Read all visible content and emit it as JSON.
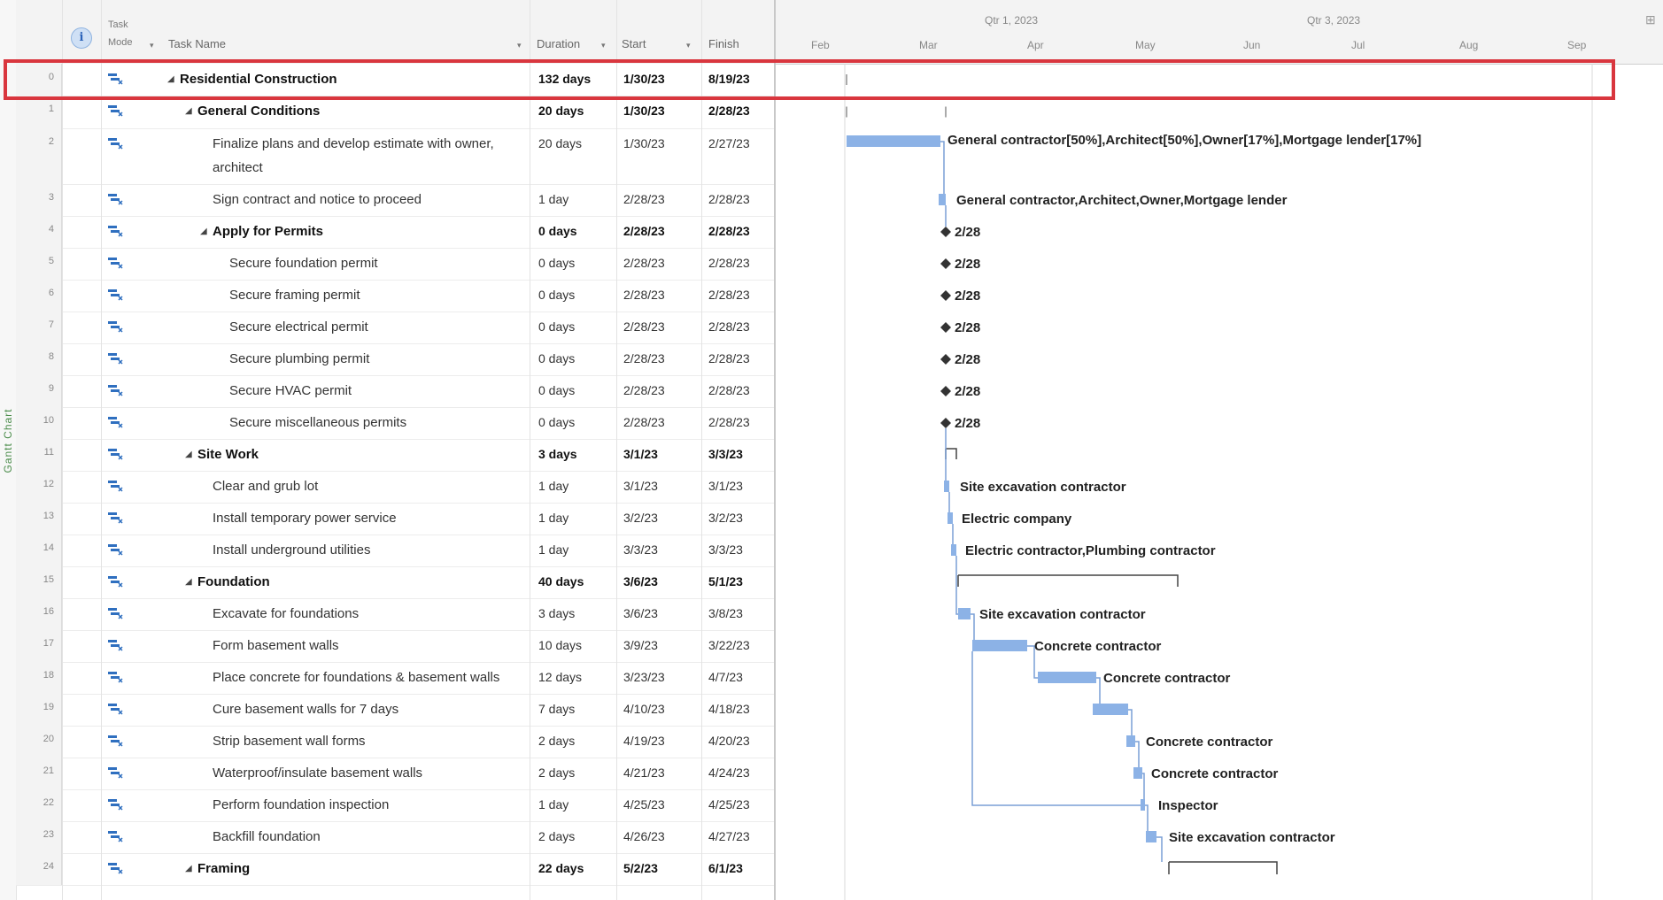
{
  "side_label": "Gantt Chart",
  "columns": {
    "mode_top": "Task",
    "mode_bottom": "Mode",
    "name": "Task Name",
    "duration": "Duration",
    "start": "Start",
    "finish": "Finish"
  },
  "timeline": {
    "quarters": [
      "Qtr 1, 2023",
      "Qtr 3, 2023"
    ],
    "months": [
      "Feb",
      "Mar",
      "Apr",
      "May",
      "Jun",
      "Jul",
      "Aug",
      "Sep"
    ]
  },
  "tasks": [
    {
      "id": "0",
      "name": "Residential Construction",
      "duration": "132 days",
      "start": "1/30/23",
      "finish": "8/19/23",
      "level": 0,
      "summary": true
    },
    {
      "id": "1",
      "name": "General Conditions",
      "duration": "20 days",
      "start": "1/30/23",
      "finish": "2/28/23",
      "level": 1,
      "summary": true
    },
    {
      "id": "2",
      "name": "Finalize plans and develop estimate with owner,",
      "name2": "architect",
      "duration": "20 days",
      "start": "1/30/23",
      "finish": "2/27/23",
      "level": 2,
      "summary": false
    },
    {
      "id": "3",
      "name": "Sign contract and notice to proceed",
      "duration": "1 day",
      "start": "2/28/23",
      "finish": "2/28/23",
      "level": 2,
      "summary": false
    },
    {
      "id": "4",
      "name": "Apply for Permits",
      "duration": "0 days",
      "start": "2/28/23",
      "finish": "2/28/23",
      "level": 2,
      "summary": true
    },
    {
      "id": "5",
      "name": "Secure foundation permit",
      "duration": "0 days",
      "start": "2/28/23",
      "finish": "2/28/23",
      "level": 3,
      "summary": false
    },
    {
      "id": "6",
      "name": "Secure framing permit",
      "duration": "0 days",
      "start": "2/28/23",
      "finish": "2/28/23",
      "level": 3,
      "summary": false
    },
    {
      "id": "7",
      "name": "Secure electrical permit",
      "duration": "0 days",
      "start": "2/28/23",
      "finish": "2/28/23",
      "level": 3,
      "summary": false
    },
    {
      "id": "8",
      "name": "Secure plumbing permit",
      "duration": "0 days",
      "start": "2/28/23",
      "finish": "2/28/23",
      "level": 3,
      "summary": false
    },
    {
      "id": "9",
      "name": "Secure HVAC permit",
      "duration": "0 days",
      "start": "2/28/23",
      "finish": "2/28/23",
      "level": 3,
      "summary": false
    },
    {
      "id": "10",
      "name": "Secure miscellaneous permits",
      "duration": "0 days",
      "start": "2/28/23",
      "finish": "2/28/23",
      "level": 3,
      "summary": false
    },
    {
      "id": "11",
      "name": "Site Work",
      "duration": "3 days",
      "start": "3/1/23",
      "finish": "3/3/23",
      "level": 1,
      "summary": true
    },
    {
      "id": "12",
      "name": "Clear and grub lot",
      "duration": "1 day",
      "start": "3/1/23",
      "finish": "3/1/23",
      "level": 2,
      "summary": false
    },
    {
      "id": "13",
      "name": "Install temporary power service",
      "duration": "1 day",
      "start": "3/2/23",
      "finish": "3/2/23",
      "level": 2,
      "summary": false
    },
    {
      "id": "14",
      "name": "Install underground utilities",
      "duration": "1 day",
      "start": "3/3/23",
      "finish": "3/3/23",
      "level": 2,
      "summary": false
    },
    {
      "id": "15",
      "name": "Foundation",
      "duration": "40 days",
      "start": "3/6/23",
      "finish": "5/1/23",
      "level": 1,
      "summary": true
    },
    {
      "id": "16",
      "name": "Excavate for foundations",
      "duration": "3 days",
      "start": "3/6/23",
      "finish": "3/8/23",
      "level": 2,
      "summary": false
    },
    {
      "id": "17",
      "name": "Form basement walls",
      "duration": "10 days",
      "start": "3/9/23",
      "finish": "3/22/23",
      "level": 2,
      "summary": false
    },
    {
      "id": "18",
      "name": "Place concrete for foundations & basement walls",
      "duration": "12 days",
      "start": "3/23/23",
      "finish": "4/7/23",
      "level": 2,
      "summary": false
    },
    {
      "id": "19",
      "name": "Cure basement walls for 7 days",
      "duration": "7 days",
      "start": "4/10/23",
      "finish": "4/18/23",
      "level": 2,
      "summary": false
    },
    {
      "id": "20",
      "name": "Strip basement wall forms",
      "duration": "2 days",
      "start": "4/19/23",
      "finish": "4/20/23",
      "level": 2,
      "summary": false
    },
    {
      "id": "21",
      "name": "Waterproof/insulate basement walls",
      "duration": "2 days",
      "start": "4/21/23",
      "finish": "4/24/23",
      "level": 2,
      "summary": false
    },
    {
      "id": "22",
      "name": "Perform foundation inspection",
      "duration": "1 day",
      "start": "4/25/23",
      "finish": "4/25/23",
      "level": 2,
      "summary": false
    },
    {
      "id": "23",
      "name": "Backfill foundation",
      "duration": "2 days",
      "start": "4/26/23",
      "finish": "4/27/23",
      "level": 2,
      "summary": false
    },
    {
      "id": "24",
      "name": "Framing",
      "duration": "22 days",
      "start": "5/2/23",
      "finish": "6/1/23",
      "level": 1,
      "summary": true
    }
  ],
  "gantt_labels": {
    "t2": "General contractor[50%],Architect[50%],Owner[17%],Mortgage lender[17%]",
    "t3": "General contractor,Architect,Owner,Mortgage lender",
    "t4": "2/28",
    "t5": "2/28",
    "t6": "2/28",
    "t7": "2/28",
    "t8": "2/28",
    "t9": "2/28",
    "t12": "Site excavation contractor",
    "t13": "Electric company",
    "t14": "Electric contractor,Plumbing contractor",
    "t16": "Site excavation contractor",
    "t17": "Concrete contractor",
    "t18": "Concrete contractor",
    "t20": "Concrete contractor",
    "t21": "Concrete contractor",
    "t22": "Inspector",
    "t23": "Site excavation contractor"
  },
  "colors": {
    "bar": "#8cb2e6",
    "link": "#7a9fd6",
    "selection": "#d9363e"
  }
}
